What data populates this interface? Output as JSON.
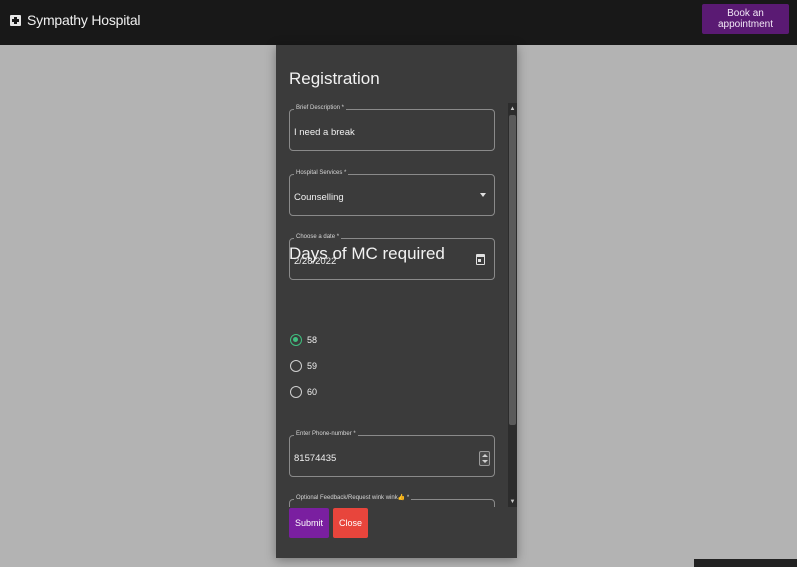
{
  "header": {
    "brand": "Sympathy Hospital",
    "brand_icon": "hospital-plus-icon",
    "book_button": "Book an appointment",
    "book_button_color": "#5a1a73"
  },
  "dialog": {
    "title": "Registration",
    "fields": {
      "description": {
        "label": "Brief Description *",
        "value": "I need a break"
      },
      "services": {
        "label": "Hospital Services *",
        "value": "Counselling"
      },
      "date": {
        "label": "Choose a date *",
        "value": "2/28/2022"
      },
      "phone": {
        "label": "Enter Phone-number *",
        "value": "81574435"
      },
      "feedback": {
        "label": "Optional Feedback/Request wink wink👍 *"
      }
    },
    "mc_section": {
      "title": "Days of MC required",
      "options": [
        {
          "label": "58",
          "checked": true
        },
        {
          "label": "59",
          "checked": false
        },
        {
          "label": "60",
          "checked": false
        }
      ],
      "accent_color": "#3fbf7f"
    },
    "actions": {
      "submit": "Submit",
      "submit_color": "#7a1fa0",
      "close": "Close",
      "close_color": "#e8453c"
    }
  }
}
